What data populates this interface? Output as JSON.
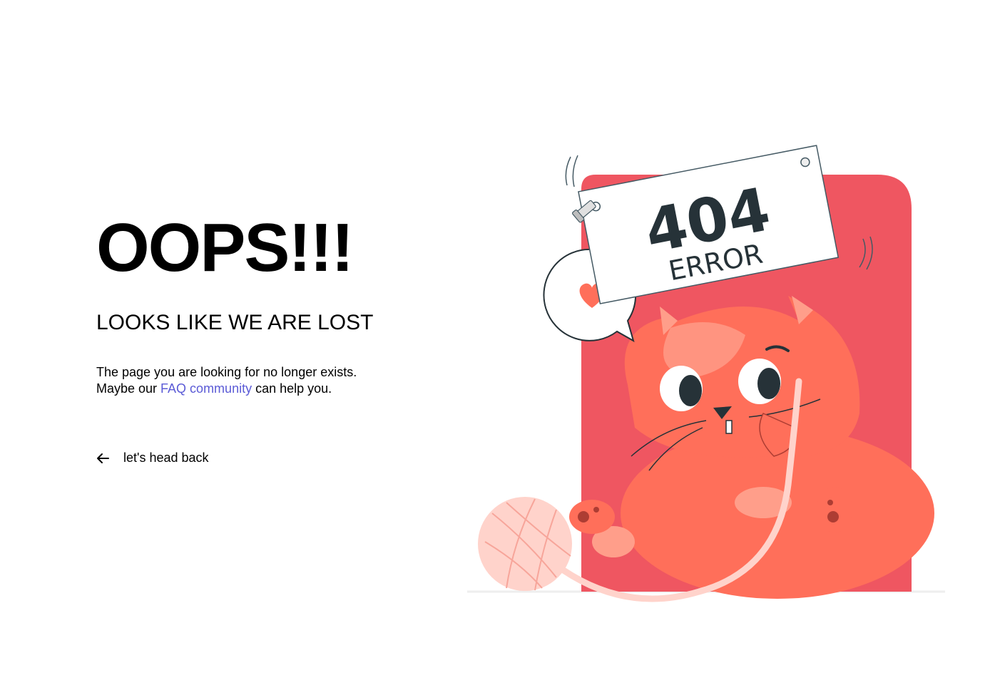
{
  "hero": {
    "title": "OOPS!!!",
    "subtitle": "LOOKS LIKE WE ARE LOST",
    "message_line1": "The page you are looking for no longer exists.",
    "message_prefix": "Maybe our ",
    "faq_link": "FAQ community",
    "message_suffix": " can help you.",
    "back_label": "let's head back",
    "back_icon": "arrow-left-icon"
  },
  "illustration": {
    "sign_code": "404",
    "sign_label": "ERROR",
    "bubble_icon": "heart-icon"
  },
  "colors": {
    "link": "#5b5bd6",
    "panel": "#ef5661",
    "cat": "#ff6f5a",
    "cat_light": "#ff9e8a",
    "yarn": "#ffd3cb"
  }
}
